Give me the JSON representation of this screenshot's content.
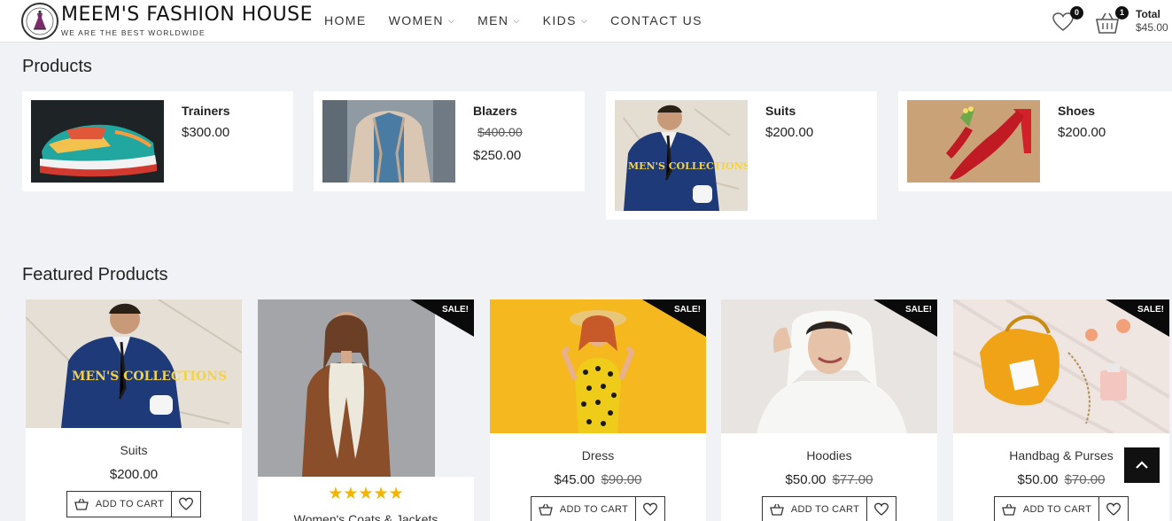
{
  "header": {
    "brand_name": "MEEM'S FASHION HOUSE",
    "brand_tagline": "WE ARE THE BEST WORLDWIDE",
    "nav": [
      {
        "label": "HOME",
        "has_dropdown": false
      },
      {
        "label": "WOMEN",
        "has_dropdown": true
      },
      {
        "label": "MEN",
        "has_dropdown": true
      },
      {
        "label": "KIDS",
        "has_dropdown": true
      },
      {
        "label": "CONTACT US",
        "has_dropdown": false
      }
    ],
    "wishlist_count": "0",
    "cart_count": "1",
    "total_label": "Total",
    "total_value": "$45.00"
  },
  "products_section": {
    "title": "Products",
    "items": [
      {
        "name": "Trainers",
        "price": "$300.00",
        "image": "colorful-sneaker-photo"
      },
      {
        "name": "Blazers",
        "old_price": "$400.00",
        "price": "$250.00",
        "image": "beige-blazer-photo"
      },
      {
        "name": "Suits",
        "price": "$200.00",
        "image": "mens-collection-suit-photo",
        "image_text": "MEN'S COLLECTIONS"
      },
      {
        "name": "Shoes",
        "price": "$200.00",
        "image": "red-heel-shoe-photo"
      }
    ]
  },
  "featured_section": {
    "title": "Featured Products",
    "sale_label": "SALE!",
    "add_to_cart_label": "ADD TO CART",
    "items": [
      {
        "name": "Suits",
        "price": "$200.00",
        "sale": false,
        "image_text": "MEN'S COLLECTIONS"
      },
      {
        "name": "Women's Coats & Jackets",
        "sale": true,
        "rating": 5
      },
      {
        "name": "Dress",
        "price": "$45.00",
        "old_price": "$90.00",
        "sale": true
      },
      {
        "name": "Hoodies",
        "price": "$50.00",
        "old_price": "$77.00",
        "sale": true
      },
      {
        "name": "Handbag & Purses",
        "price": "$50.00",
        "old_price": "$70.00",
        "sale": true
      }
    ]
  },
  "colors": {
    "accent": "#111111",
    "background": "#f1f2f6",
    "sale_badge": "#0a0a0a",
    "star": "#f5b400"
  }
}
